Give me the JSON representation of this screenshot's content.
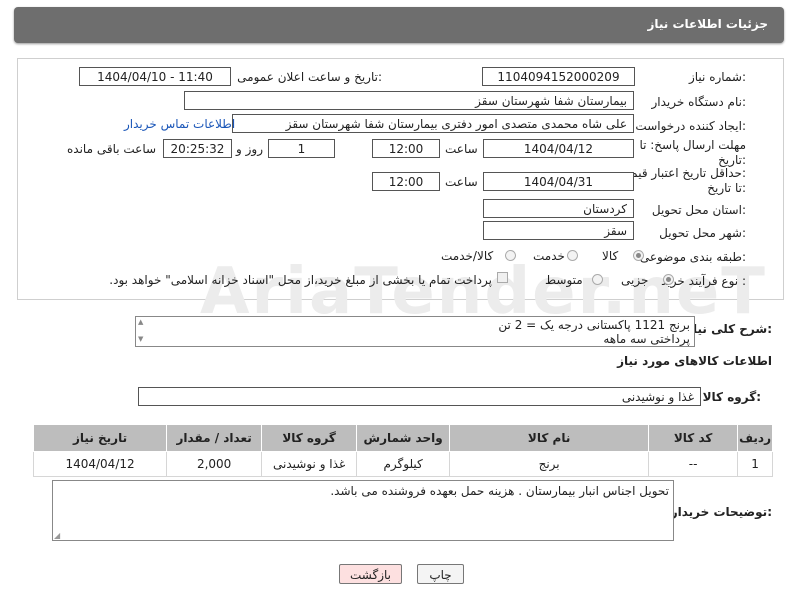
{
  "header": {
    "title": "جزئیات اطلاعات نیاز"
  },
  "watermark": "AriaTender.neT",
  "form": {
    "need_number": {
      "label": "شماره نیاز:",
      "value": "1104094152000209"
    },
    "announce_datetime": {
      "label": "تاریخ و ساعت اعلان عمومی:",
      "value": "1404/04/10 - 11:40"
    },
    "buyer_org": {
      "label": "نام دستگاه خریدار:",
      "value": "بیمارستان شفا شهرستان سقز"
    },
    "requester": {
      "label": "ایجاد کننده درخواست:",
      "value": "علی شاه محمدی متصدی امور دفتری بیمارستان شفا شهرستان سقز",
      "contact_link": "اطلاعات تماس خریدار"
    },
    "reply_deadline": {
      "label_line1": "مهلت ارسال پاسخ: تا",
      "label_line2": "تاریخ:",
      "date": "1404/04/12",
      "time_label": "ساعت",
      "time": "12:00",
      "days": "1",
      "days_label": "روز و",
      "remaining": "20:25:32",
      "remaining_label": "ساعت باقی مانده"
    },
    "price_validity": {
      "label_line1": "حداقل تاریخ اعتبار قیمت:",
      "label_line2": "تا تاریخ:",
      "date": "1404/04/31",
      "time_label": "ساعت",
      "time": "12:00"
    },
    "province": {
      "label": "استان محل تحویل:",
      "value": "کردستان"
    },
    "city": {
      "label": "شهر محل تحویل:",
      "value": "سقز"
    },
    "category": {
      "label": "طبقه بندی موضوعی:",
      "options": [
        "کالا",
        "خدمت",
        "کالا/خدمت"
      ],
      "selected": "کالا"
    },
    "process": {
      "label": "نوع فرآیند خرید :",
      "options": [
        "جزیی",
        "متوسط"
      ],
      "selected": "جزیی",
      "note": "پرداخت تمام یا بخشی از مبلغ خرید،از محل \"اسناد خزانه اسلامی\" خواهد بود."
    }
  },
  "description": {
    "label": "شرح کلی نیاز:",
    "line1": "برنج 1121 پاکستانی درجه یک  = 2 تن",
    "line2": "پرداختی سه ماهه"
  },
  "goods": {
    "section_title": "اطلاعات کالاهای مورد نیاز",
    "group_label": "گروه کالا:",
    "group_value": "غذا و نوشیدنی",
    "columns": [
      "ردیف",
      "کد کالا",
      "نام کالا",
      "واحد شمارش",
      "گروه کالا",
      "تعداد / مقدار",
      "تاریخ نیاز"
    ],
    "rows": [
      {
        "row": "1",
        "code": "--",
        "name": "برنج",
        "unit": "کیلوگرم",
        "group": "غذا و نوشیدنی",
        "qty": "2,000",
        "date": "1404/04/12"
      }
    ]
  },
  "buyer_notes": {
    "label": "توضیحات خریدار:",
    "value": "تحویل اجناس  انبار بیمارستان . هزینه حمل بعهده فروشنده می باشد."
  },
  "buttons": {
    "print": "چاپ",
    "back": "بازگشت"
  },
  "colors": {
    "title_bg": "#6e6e6e",
    "table_header_bg": "#bdbdbd",
    "back_button_bg": "#fde0e0",
    "link": "#1a56b8"
  }
}
